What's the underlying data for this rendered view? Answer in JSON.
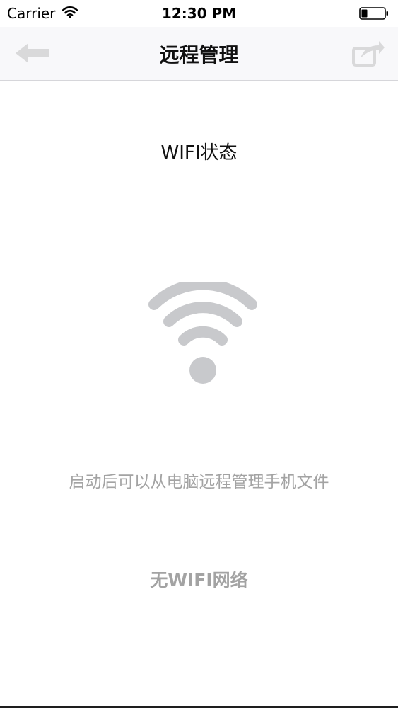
{
  "status_bar": {
    "carrier": "Carrier",
    "time": "12:30 PM",
    "wifi_icon": "wifi-icon",
    "battery_icon": "battery-icon"
  },
  "nav_bar": {
    "title": "远程管理",
    "back_icon": "back-arrow-icon",
    "share_icon": "share-icon"
  },
  "content": {
    "section_title": "WIFI状态",
    "wifi_icon": "wifi-icon",
    "description": "启动后可以从电脑远程管理手机文件",
    "network_status": "无WIFI网络"
  },
  "colors": {
    "icon_gray": "#c8c9cc",
    "hint_text": "#a3a3a3",
    "nav_background": "#f8f8fa"
  }
}
